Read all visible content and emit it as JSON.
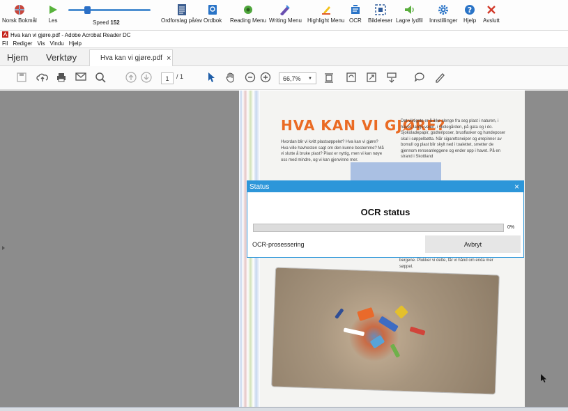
{
  "toolbar": {
    "buttons": [
      {
        "id": "language",
        "label": "Norsk Bokmål",
        "icon": "globe-flag-icon"
      },
      {
        "id": "read",
        "label": "Les",
        "icon": "play-icon"
      },
      {
        "id": "word-prediction",
        "label": "Ordforslag på/av",
        "icon": "document-icon"
      },
      {
        "id": "dictionary",
        "label": "Ordbok",
        "icon": "dictionary-icon"
      },
      {
        "id": "reading-menu",
        "label": "Reading Menu",
        "icon": "reading-menu-icon"
      },
      {
        "id": "writing-menu",
        "label": "Writing Menu",
        "icon": "writing-menu-icon"
      },
      {
        "id": "highlight-menu",
        "label": "Highlight Menu",
        "icon": "highlighter-icon"
      },
      {
        "id": "ocr",
        "label": "OCR",
        "icon": "ocr-icon"
      },
      {
        "id": "picture-text",
        "label": "Bildeleser",
        "icon": "picture-reader-icon"
      },
      {
        "id": "save-audio",
        "label": "Lagre lydfil",
        "icon": "save-audio-icon"
      },
      {
        "id": "settings",
        "label": "Innstillinger",
        "icon": "gear-icon"
      },
      {
        "id": "help",
        "label": "Hjelp",
        "icon": "help-icon"
      },
      {
        "id": "exit",
        "label": "Avslutt",
        "icon": "close-icon"
      }
    ],
    "speed_label": "Speed",
    "speed_value": "152",
    "speed_fraction": 0.23
  },
  "window": {
    "title": "Hva kan vi gjøre.pdf - Adobe Acrobat Reader DC"
  },
  "menubar": {
    "items": [
      "Fil",
      "Rediger",
      "Vis",
      "Vindu",
      "Hjelp"
    ]
  },
  "tabs": {
    "home": "Hjem",
    "tools": "Verktøy",
    "document": "Hva kan vi gjøre.pdf",
    "close_glyph": "×"
  },
  "doc_toolbar": {
    "page_current": "1",
    "page_total": "/ 1",
    "zoom": "66,7%"
  },
  "document": {
    "heading": "HVA KAN VI GJØRE?",
    "col_left": "Hvordan blir vi kvitt plastsøppelet? Hva kan vi gjøre? Hva ville havhesten sagt om den kunne bestemme? Må vi slutte å bruke plast? Plast er nyttig, men vi kan nøye oss med mindre, og vi kan gjenvinne mer.",
    "col_right": "Det viktigste er å ikke slenge fra seg plast i naturen, i havet, langs veien, i skolegården, på gata og i do. Sjokoladepapir, godteriposer, brusflasker og hundeposer skal i søppelbøtta. Når sigarettsneiper og ørepinner av bomull og plast blir skylt ned i toalettet, smetter de gjennom renseanleggene og ender opp i havet. På en strand i Skottland",
    "col_right_bottom": "bergene. Plukker vi dette, får vi hånd om enda mer søppel."
  },
  "status_dialog": {
    "title": "Status",
    "close_glyph": "×",
    "heading": "OCR status",
    "progress": 0,
    "progress_text": "0%",
    "status_text": "OCR-prosessering",
    "abort_label": "Avbryt"
  },
  "colors": {
    "dialog_accent": "#2d96d9",
    "heading_orange": "#ea6b24",
    "progress_green": "#41a941"
  }
}
